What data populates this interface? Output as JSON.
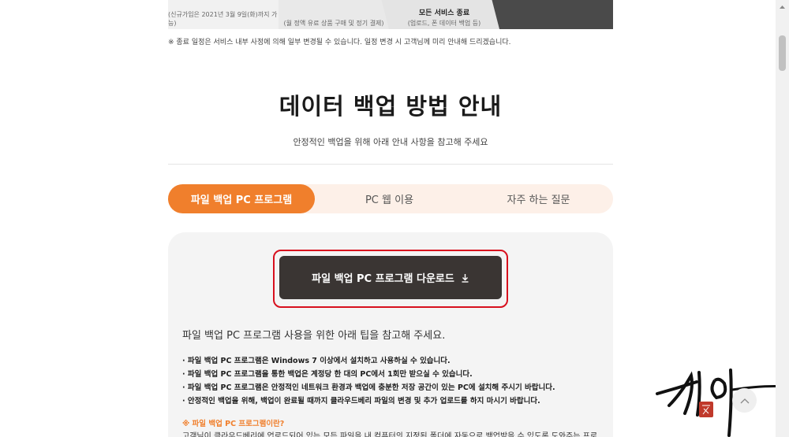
{
  "steps": [
    {
      "line": "(신규가입은 2021년 3월 9일(화)까지 가능)",
      "title": ""
    },
    {
      "line": "(월 정액 유료 상품 구매 및 정기 결제)",
      "title": ""
    },
    {
      "line": "(업로드, 폰 데이터 백업 등)",
      "title": "모든 서비스 종료"
    },
    {
      "line": "",
      "title": ""
    }
  ],
  "note": "※ 종료 일정은 서비스 내부 사정에 의해 일부 변경될 수 있습니다. 일정 변경 시 고객님께 미리 안내해 드리겠습니다.",
  "heading": {
    "title": "데이터 백업 방법 안내",
    "subtitle": "안정적인 백업을 위해 아래 안내 사항을 참고해 주세요"
  },
  "tabs": [
    {
      "label": "파일 백업 PC 프로그램",
      "active": true
    },
    {
      "label": "PC 웹 이용",
      "active": false
    },
    {
      "label": "자주 하는 질문",
      "active": false
    }
  ],
  "download": {
    "label": "파일 백업 PC 프로그램 다운로드",
    "icon": "download-icon"
  },
  "tip_title": "파일 백업 PC 프로그램 사용을 위한 아래 팁을 참고해 주세요.",
  "tips": [
    "· 파일 백업 PC 프로그램은 Windows 7 이상에서 설치하고 사용하실 수 있습니다.",
    "· 파일 백업 PC 프로그램을 통한 백업은 계정당 한 대의 PC에서 1회만 받으실 수 있습니다.",
    "· 파일 백업 PC 프로그램은 안정적인 네트워크 환경과 백업에 충분한 저장 공간이 있는 PC에 설치해 주시기 바랍니다.",
    "· 안정적인 백업을 위해, 백업이 완료될 때까지 클라우드베리 파일의 변경 및 추가 업로드를 하지 마시기 바랍니다."
  ],
  "what": {
    "title": "※ 파일 백업 PC 프로그램이란?",
    "body": "고객님이 클라우드베리에 업로드되어 있는 모든 파일을 내 컴퓨터의 지정된 폴더에 자동으로 백업받을 수 있도록 도와주는 프로"
  },
  "colors": {
    "accent": "#f07f2c",
    "tab_bg": "#fdf0e8",
    "button": "#3a3533",
    "highlight": "#d8101e"
  }
}
